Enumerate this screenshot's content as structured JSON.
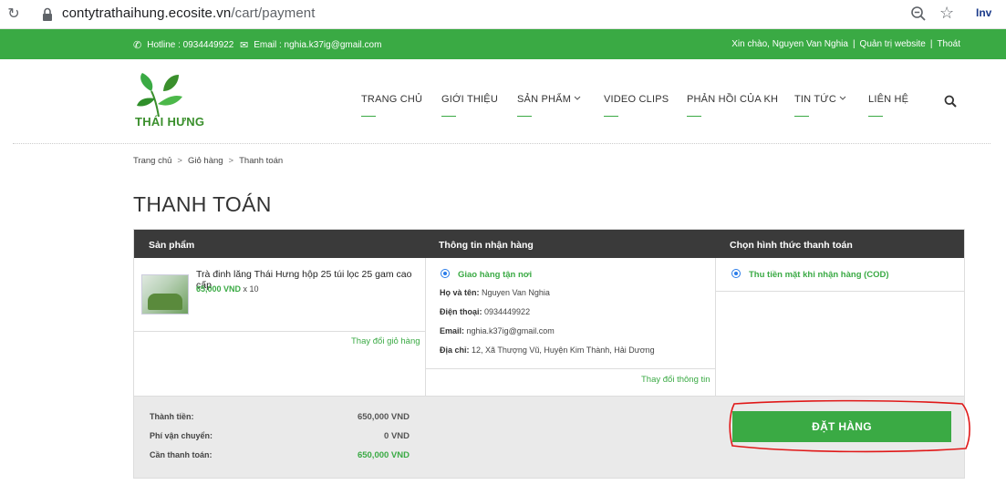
{
  "browser": {
    "url_domain": "contytrathaihung.ecosite.vn",
    "url_path": "/cart/payment",
    "extension_label": "Inv"
  },
  "topbar": {
    "hotline": "Hotline : 0934449922",
    "email": "Email : nghia.k37ig@gmail.com",
    "greeting": "Xin chào, Nguyen Van Nghia",
    "admin_link": "Quản trị website",
    "logout_link": "Thoát",
    "separator": "|",
    "accent_color": "#3aaa44"
  },
  "logo": {
    "text": "THÁI HƯNG"
  },
  "nav": {
    "items": [
      {
        "label": "TRANG CHỦ"
      },
      {
        "label": "GIỚI THIỆU"
      },
      {
        "label": "SẢN PHẨM",
        "has_dropdown": true
      },
      {
        "label": "VIDEO CLIPS"
      },
      {
        "label": "PHẢN HỒI CỦA KH"
      },
      {
        "label": "TIN TỨC",
        "has_dropdown": true
      },
      {
        "label": "LIÊN HỆ"
      }
    ],
    "search_icon": "search-icon"
  },
  "breadcrumb": {
    "items": [
      "Trang chủ",
      "Giỏ hàng",
      "Thanh toán"
    ],
    "separator": ">"
  },
  "page": {
    "title": "THANH TOÁN"
  },
  "checkout": {
    "headers": {
      "products": "Sản phẩm",
      "shipping": "Thông tin nhận hàng",
      "payment": "Chọn hình thức thanh toán"
    },
    "product": {
      "name": "Trà đinh lăng Thái Hưng hộp 25 túi lọc 25 gam cao cấp",
      "price": "65,000 VND",
      "quantity": "x 10"
    },
    "change_cart": "Thay đổi giỏ hàng",
    "shipping": {
      "option": "Giao hàng tận nơi",
      "name_label": "Họ và tên:",
      "name": "Nguyen Van Nghia",
      "phone_label": "Điện thoại:",
      "phone": "0934449922",
      "email_label": "Email:",
      "email": "nghia.k37ig@gmail.com",
      "address_label": "Địa chỉ:",
      "address": "12, Xã Thượng Vũ, Huyện Kim Thành, Hải Dương",
      "change_info": "Thay đổi thông tin"
    },
    "payment": {
      "option": "Thu tiền mặt khi nhận hàng (COD)"
    },
    "summary": {
      "subtotal_label": "Thành tiền:",
      "subtotal": "650,000 VND",
      "shipping_label": "Phí vận chuyển:",
      "shipping_fee": "0 VND",
      "total_label": "Cần thanh toán:",
      "total": "650,000 VND"
    },
    "order_button": "ĐẶT HÀNG"
  }
}
